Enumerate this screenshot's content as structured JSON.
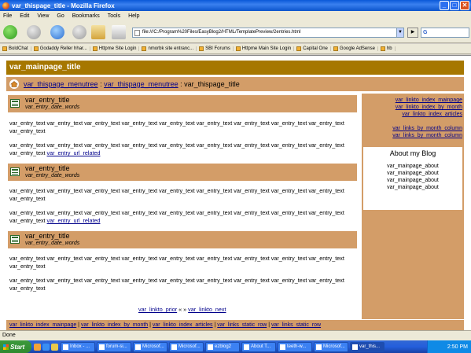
{
  "window": {
    "title": "var_thispage_title - Mozilla Firefox",
    "minimize": "_",
    "maximize": "□",
    "close": "✕"
  },
  "menu": [
    "File",
    "Edit",
    "View",
    "Go",
    "Bookmarks",
    "Tools",
    "Help"
  ],
  "navbar": {
    "url": "file:///C:/Program%20Files/EasyBlog2/HTML/TemplatePreview/2entries.html",
    "search_label": "G"
  },
  "bookmarks": [
    "BoldChat",
    "Godaddy Reller hhar...",
    "Httpme Site Login",
    "nmorbk site entranc...",
    "SBI Forums",
    "Httpme Main Site Login",
    "Capital One",
    "Google AdSense",
    "hb"
  ],
  "page": {
    "title": "var_mainpage_title",
    "breadcrumb": {
      "link1": "var_thispage_menutree",
      "sep1": " : ",
      "link2": "var_thispage_menutree",
      "sep2": " : ",
      "current": "var_thispage_title"
    },
    "entries": [
      {
        "title": "var_entry_title",
        "date": "var_entry_date_words",
        "para1": "var_entry_text var_entry_text var_entry_text var_entry_text var_entry_text var_entry_text var_entry_text var_entry_text var_entry_text var_entry_text",
        "para2": "var_entry_text var_entry_text var_entry_text var_entry_text var_entry_text var_entry_text var_entry_text var_entry_text var_entry_text var_entry_text",
        "related": "var_entry_url_related"
      },
      {
        "title": "var_entry_title",
        "date": "var_entry_date_words",
        "para1": "var_entry_text var_entry_text var_entry_text var_entry_text var_entry_text var_entry_text var_entry_text var_entry_text var_entry_text var_entry_text",
        "para2": "var_entry_text var_entry_text var_entry_text var_entry_text var_entry_text var_entry_text var_entry_text var_entry_text var_entry_text var_entry_text",
        "related": "var_entry_url_related"
      },
      {
        "title": "var_entry_title",
        "date": "var_entry_date_words",
        "para1": "var_entry_text var_entry_text var_entry_text var_entry_text var_entry_text var_entry_text var_entry_text var_entry_text var_entry_text var_entry_text",
        "para2": "var_entry_text var_entry_text var_entry_text var_entry_text var_entry_text var_entry_text var_entry_text var_entry_text var_entry_text var_entry_text"
      }
    ],
    "pager": {
      "prior": "var_linkto_prior",
      "sep": " « » ",
      "next": "var_linkto_next"
    },
    "sidebar": {
      "links": [
        "var_linkto_index_mainpage",
        "var_linkto_index_by_month",
        "var_linkto_index_articles"
      ],
      "month_links": [
        "var_links_by_month_column",
        "var_links_by_month_column"
      ],
      "about_title": "About my Blog",
      "about_lines": [
        "var_mainpage_about",
        "var_mainpage_about",
        "var_mainpage_about",
        "var_mainpage_about"
      ]
    },
    "footer": {
      "l1": "var_linkto_index_mainpage",
      "l2": "var_linkto_index_by_month",
      "l3": "var_linkto_index_articles",
      "l4": "var_links_static_row",
      "l5": "var_links_static_row",
      "sep": " | "
    }
  },
  "status": "Done",
  "taskbar": {
    "start": "Start",
    "tasks": [
      "Inbox - ...",
      "forum-si...",
      "Microsof...",
      "Microsof...",
      "ezblog2",
      "About T...",
      "teeth-w...",
      "Microsof...",
      "var_this..."
    ],
    "clock": "2:50 PM"
  }
}
